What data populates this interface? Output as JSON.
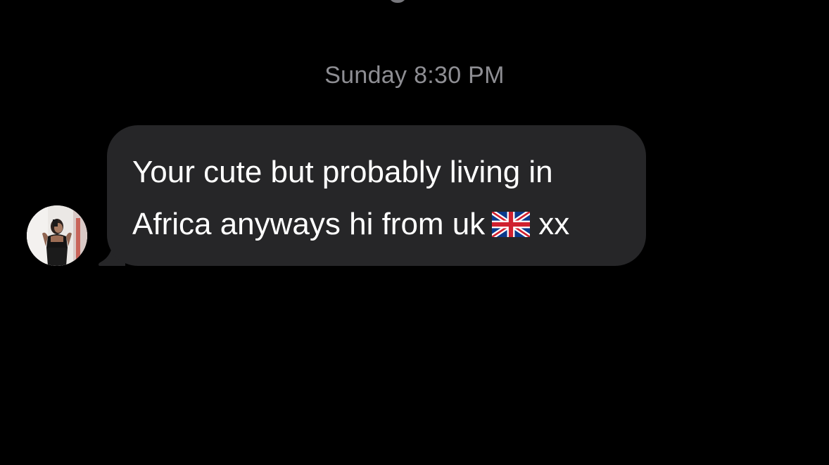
{
  "conversation": {
    "timestamp": "Sunday 8:30 PM",
    "messages": [
      {
        "direction": "incoming",
        "text_before_emoji": "Your cute but probably living in Africa anyways hi from uk",
        "emoji": "uk-flag-icon",
        "text_after_emoji": "xx",
        "avatar": "avatar-photo"
      }
    ]
  },
  "colors": {
    "background": "#000000",
    "bubble": "#262628",
    "timestamp_text": "#8e8e93",
    "message_text": "#ffffff"
  }
}
